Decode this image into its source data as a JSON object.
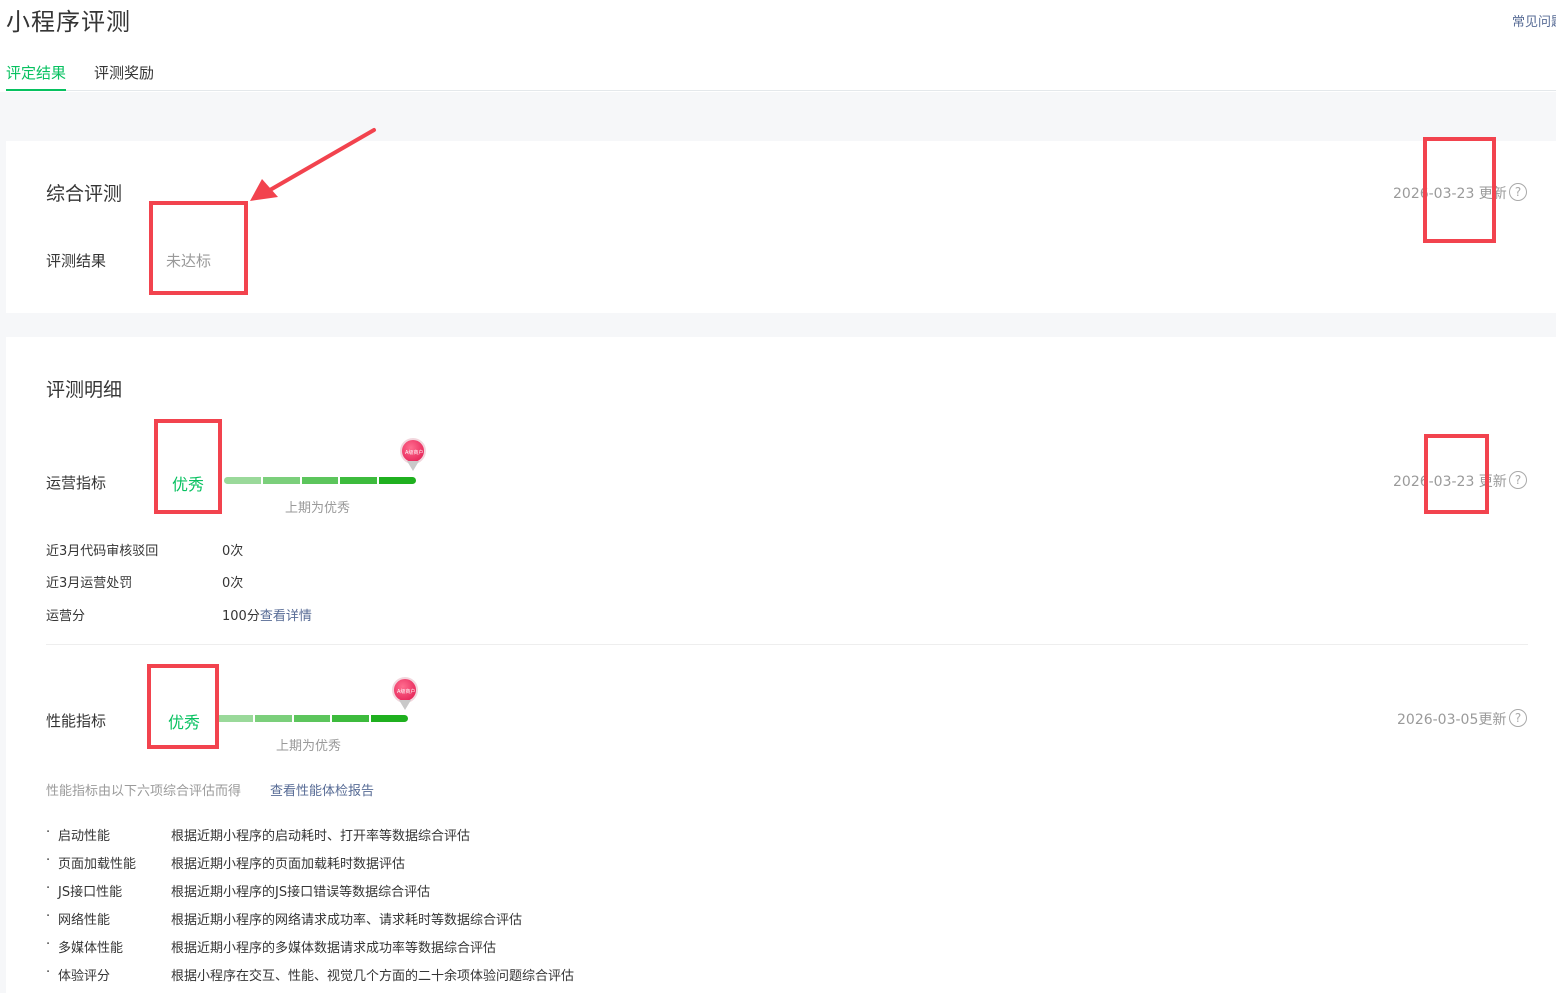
{
  "header": {
    "title": "小程序评测",
    "faq_link": "常见问题"
  },
  "tabs": [
    {
      "label": "评定结果",
      "active": true
    },
    {
      "label": "评测奖励",
      "active": false
    }
  ],
  "summary": {
    "title": "综合评测",
    "result_label": "评测结果",
    "result_value": "未达标",
    "updated": "2026-03-23 更新"
  },
  "details": {
    "title": "评测明细",
    "operations": {
      "label": "运营指标",
      "grade": "优秀",
      "previous": "上期为优秀",
      "updated": "2026-03-23 更新",
      "rows": [
        {
          "label": "近3月代码审核驳回",
          "value": "0次"
        },
        {
          "label": "近3月运营处罚",
          "value": "0次"
        },
        {
          "label": "运营分",
          "value": "100分",
          "link": "查看详情"
        }
      ]
    },
    "performance": {
      "label": "性能指标",
      "grade": "优秀",
      "previous": "上期为优秀",
      "updated": "2026-03-05更新",
      "note": "性能指标由以下六项综合评估而得",
      "report_link": "查看性能体检报告",
      "items": [
        {
          "name": "启动性能",
          "desc": "根据近期小程序的启动耗时、打开率等数据综合评估"
        },
        {
          "name": "页面加载性能",
          "desc": "根据近期小程序的页面加载耗时数据评估"
        },
        {
          "name": "JS接口性能",
          "desc": "根据近期小程序的JS接口错误等数据综合评估"
        },
        {
          "name": "网络性能",
          "desc": "根据近期小程序的网络请求成功率、请求耗时等数据综合评估"
        },
        {
          "name": "多媒体性能",
          "desc": "根据近期小程序的多媒体数据请求成功率等数据综合评估"
        },
        {
          "name": "体验评分",
          "desc": "根据小程序在交互、性能、视觉几个方面的二十余项体验问题综合评估"
        }
      ]
    }
  },
  "gauge_pin_text": "A级商户",
  "colors": {
    "accent_green": "#07c160",
    "link_blue": "#576b95",
    "annotation_red": "#f2434e"
  },
  "icons": {
    "help": "question-circle-icon",
    "pin": "map-pin-icon"
  }
}
